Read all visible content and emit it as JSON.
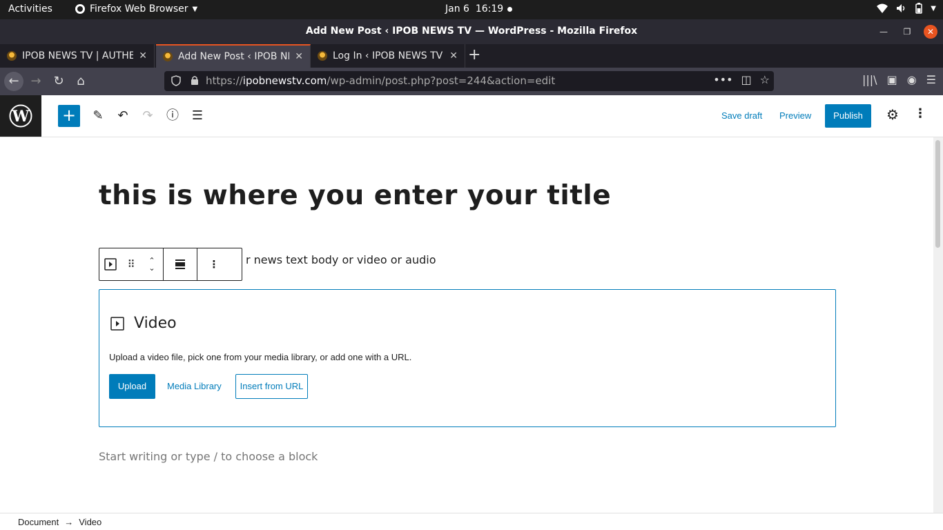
{
  "system_bar": {
    "activities": "Activities",
    "app_name": "Firefox Web Browser",
    "date": "Jan 6",
    "time": "16:19"
  },
  "window": {
    "title": "Add New Post ‹ IPOB NEWS TV — WordPress - Mozilla Firefox"
  },
  "tabs": [
    {
      "label": "IPOB NEWS TV | AUTHENTIC"
    },
    {
      "label": "Add New Post ‹ IPOB NEWS"
    },
    {
      "label": "Log In ‹ IPOB NEWS TV — WordPress"
    }
  ],
  "url": {
    "prefix": "https://",
    "host": "ipobnewstv.com",
    "path": "/wp-admin/post.php?post=244&action=edit"
  },
  "editor_header": {
    "save_draft": "Save draft",
    "preview": "Preview",
    "publish": "Publish"
  },
  "content": {
    "title": "this is where you enter your title",
    "paragraph_visible": "r news text body or video or audio",
    "video_block": {
      "title": "Video",
      "description": "Upload a video file, pick one from your media library, or add one with a URL.",
      "upload": "Upload",
      "media_library": "Media Library",
      "insert_url": "Insert from URL"
    },
    "placeholder": "Start writing or type / to choose a block"
  },
  "breadcrumbs": {
    "root": "Document",
    "arrow": "→",
    "current": "Video"
  },
  "colors": {
    "wp_blue": "#007cba",
    "ubuntu_orange": "#e95420",
    "dark": "#1e1e1e"
  }
}
